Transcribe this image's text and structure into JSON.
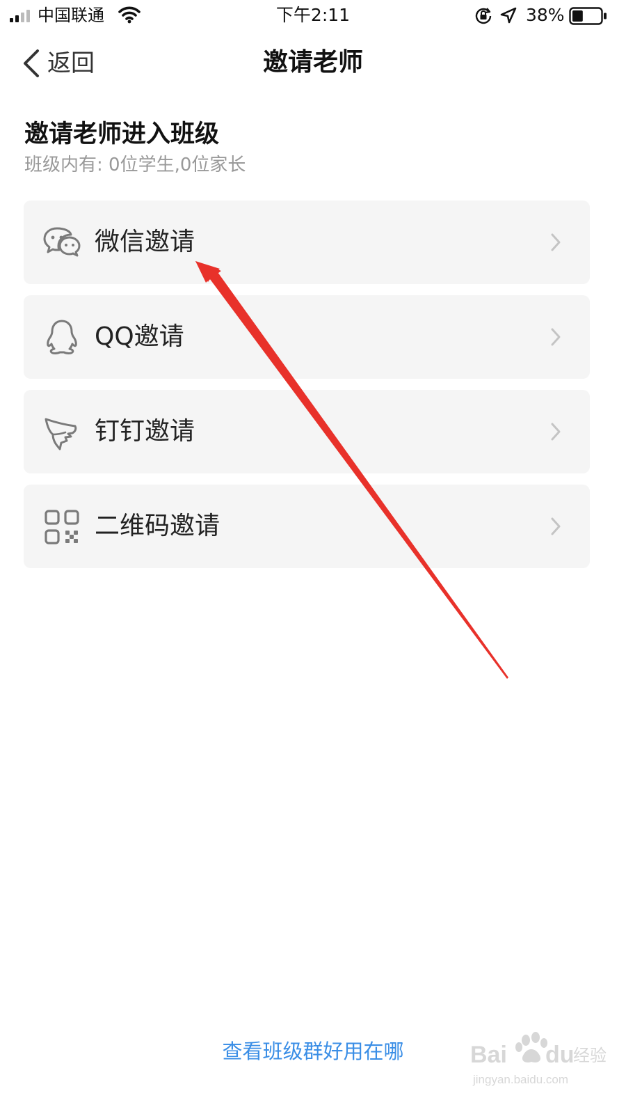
{
  "status_bar": {
    "carrier": "中国联通",
    "time": "下午2:11",
    "battery_percent": "38%",
    "battery_level": 0.38,
    "icons": [
      "signal-icon",
      "wifi-icon",
      "rotation-lock-icon",
      "location-icon",
      "battery-icon"
    ]
  },
  "nav": {
    "back_label": "返回",
    "title": "邀请老师"
  },
  "section": {
    "title": "邀请老师进入班级",
    "subtitle": "班级内有: 0位学生,0位家长"
  },
  "options": [
    {
      "label": "微信邀请",
      "icon": "wechat-icon"
    },
    {
      "label": "QQ邀请",
      "icon": "qq-icon"
    },
    {
      "label": "钉钉邀请",
      "icon": "dingtalk-icon"
    },
    {
      "label": "二维码邀请",
      "icon": "qr-code-icon"
    }
  ],
  "bottom_link": "查看班级群好用在哪",
  "watermark": {
    "brand": "Baidu经验",
    "url": "jingyan.baidu.com"
  },
  "colors": {
    "link": "#3a8ee6",
    "card_background": "#f5f5f5",
    "annotation": "#e8312a",
    "icon_gray": "#7a7a7a"
  }
}
